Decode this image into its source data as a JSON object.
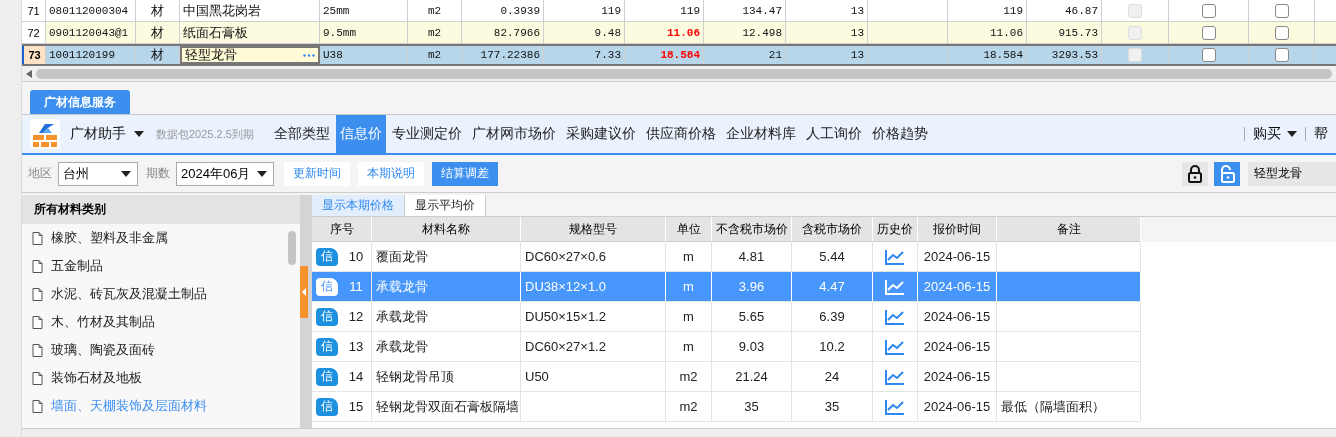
{
  "grid": {
    "rows": [
      {
        "number": "71",
        "cells": [
          "080112000304",
          "材",
          "中国黑花岗岩",
          "25mm",
          "m2",
          "0.3939",
          "119",
          "119",
          "134.47",
          "13",
          "",
          "119",
          "46.87"
        ],
        "shaded": false,
        "flagged": false,
        "selected": false,
        "editing": false,
        "checks": [
          {
            "checked": false,
            "disabled": true
          },
          {
            "checked": false,
            "disabled": false
          },
          {
            "checked": false,
            "disabled": false
          }
        ]
      },
      {
        "number": "72",
        "cells": [
          "0901120043@1",
          "材",
          "纸面石膏板",
          "9.5mm",
          "m2",
          "82.7966",
          "9.48",
          "11.06",
          "12.498",
          "13",
          "",
          "11.06",
          "915.73"
        ],
        "shaded": true,
        "flagged": true,
        "selected": false,
        "editing": false,
        "checks": [
          {
            "checked": false,
            "disabled": true
          },
          {
            "checked": false,
            "disabled": false
          },
          {
            "checked": false,
            "disabled": false
          }
        ]
      },
      {
        "number": "73",
        "cells": [
          "1001120199",
          "材",
          "轻型龙骨",
          "U38",
          "m2",
          "177.22386",
          "7.33",
          "18.584",
          "21",
          "13",
          "",
          "18.584",
          "3293.53"
        ],
        "shaded": false,
        "flagged": true,
        "selected": true,
        "editing": true,
        "checks": [
          {
            "checked": false,
            "disabled": true
          },
          {
            "checked": false,
            "disabled": false
          },
          {
            "checked": false,
            "disabled": false
          }
        ]
      }
    ]
  },
  "service_tab": {
    "label": "广材信息服务"
  },
  "toolbar": {
    "app_menu": "广材助手",
    "expiry": "数据包2025.2.5到期",
    "nav": [
      {
        "label": "全部类型",
        "selected": false
      },
      {
        "label": "信息价",
        "selected": true
      },
      {
        "label": "专业测定价",
        "selected": false
      },
      {
        "label": "广材网市场价",
        "selected": false
      },
      {
        "label": "采购建议价",
        "selected": false
      },
      {
        "label": "供应商价格",
        "selected": false
      },
      {
        "label": "企业材料库",
        "selected": false
      },
      {
        "label": "人工询价",
        "selected": false
      },
      {
        "label": "价格趋势",
        "selected": false
      }
    ],
    "buy": "购买",
    "help": "帮"
  },
  "filters": {
    "region_label": "地区",
    "region": "台州",
    "period_label": "期数",
    "period": "2024年06月",
    "buttons": [
      {
        "label": "更新时间",
        "selected": false
      },
      {
        "label": "本期说明",
        "selected": false
      },
      {
        "label": "结算调差",
        "selected": true
      }
    ],
    "locked": false,
    "search": "轻型龙骨"
  },
  "categories": {
    "title": "所有材料类别",
    "items": [
      {
        "label": "橡胶、塑料及非金属",
        "selected": false
      },
      {
        "label": "五金制品",
        "selected": false
      },
      {
        "label": "水泥、砖瓦灰及混凝土制品",
        "selected": false
      },
      {
        "label": "木、竹材及其制品",
        "selected": false
      },
      {
        "label": "玻璃、陶瓷及面砖",
        "selected": false
      },
      {
        "label": "装饰石材及地板",
        "selected": false
      },
      {
        "label": "墙面、天棚装饰及层面材料",
        "selected": true
      }
    ]
  },
  "price_tabs": [
    {
      "label": "显示本期价格",
      "selected": true
    },
    {
      "label": "显示平均价",
      "selected": false
    }
  ],
  "prices": {
    "columns": [
      "序号",
      "材料名称",
      "规格型号",
      "单位",
      "不含税市场价",
      "含税市场价",
      "历史价",
      "报价时间",
      "备注"
    ],
    "rows": [
      {
        "badge": "信",
        "number": "10",
        "name": "覆面龙骨",
        "spec": "DC60×27×0.6",
        "unit": "m",
        "price": "4.81",
        "price_tax": "5.44",
        "date": "2024-06-15",
        "note": "",
        "selected": false
      },
      {
        "badge": "信",
        "number": "11",
        "name": "承载龙骨",
        "spec": "DU38×12×1.0",
        "unit": "m",
        "price": "3.96",
        "price_tax": "4.47",
        "date": "2024-06-15",
        "note": "",
        "selected": true
      },
      {
        "badge": "信",
        "number": "12",
        "name": "承载龙骨",
        "spec": "DU50×15×1.2",
        "unit": "m",
        "price": "5.65",
        "price_tax": "6.39",
        "date": "2024-06-15",
        "note": "",
        "selected": false
      },
      {
        "badge": "信",
        "number": "13",
        "name": "承载龙骨",
        "spec": "DC60×27×1.2",
        "unit": "m",
        "price": "9.03",
        "price_tax": "10.2",
        "date": "2024-06-15",
        "note": "",
        "selected": false
      },
      {
        "badge": "信",
        "number": "14",
        "name": "轻钢龙骨吊顶",
        "spec": "U50",
        "unit": "m2",
        "price": "21.24",
        "price_tax": "24",
        "date": "2024-06-15",
        "note": "",
        "selected": false
      },
      {
        "badge": "信",
        "number": "15",
        "name": "轻钢龙骨双面石膏板隔墙",
        "spec": "",
        "unit": "m2",
        "price": "35",
        "price_tax": "35",
        "date": "2024-06-15",
        "note": "最低（隔墙面积）",
        "selected": false
      }
    ]
  }
}
